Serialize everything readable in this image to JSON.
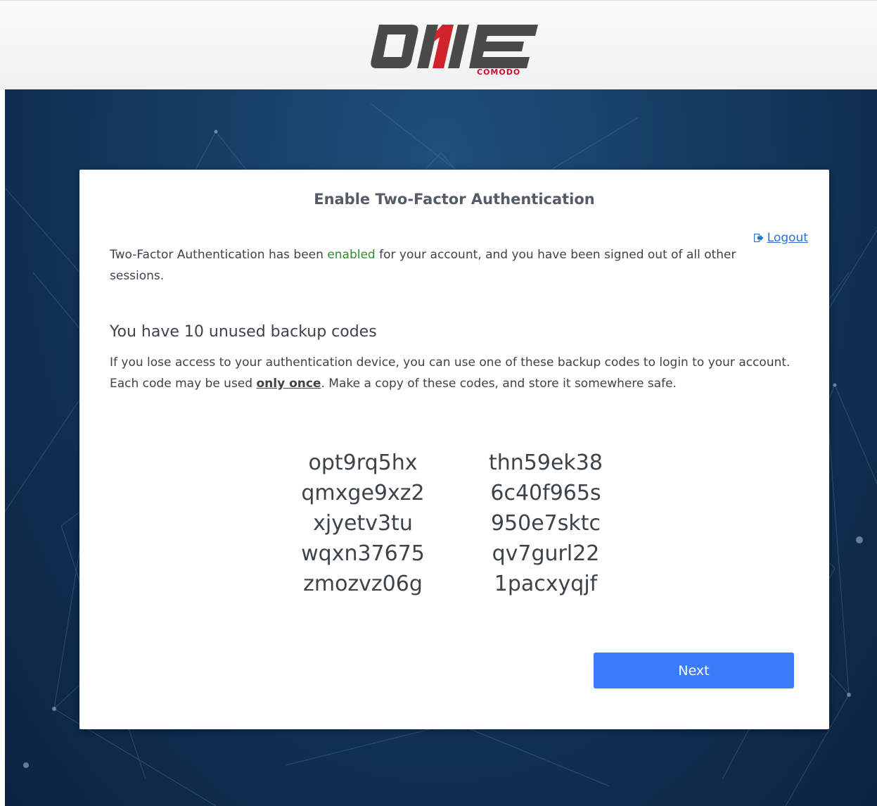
{
  "header": {
    "logo_alt": "ONE",
    "brand_sub": "COMODO"
  },
  "dialog": {
    "title": "Enable Two-Factor Authentication",
    "logout_label": "Logout",
    "status_before": "Two-Factor Authentication has been ",
    "status_highlight": "enabled",
    "status_after": " for your account, and you have been signed out of all other sessions.",
    "backup_heading": "You have 10 unused backup codes",
    "desc_before": "If you lose access to your authentication device, you can use one of these backup codes to login to your account. Each code may be used ",
    "desc_emph": "only once",
    "desc_after": ". Make a copy of these codes, and store it somewhere safe.",
    "codes_left": [
      "opt9rq5hx",
      "qmxge9xz2",
      "xjyetv3tu",
      "wqxn37675",
      "zmozvz06g"
    ],
    "codes_right": [
      "thn59ek38",
      "6c40f965s",
      "950e7sktc",
      "qv7gurl22",
      "1pacxyqjf"
    ],
    "next_label": "Next"
  },
  "colors": {
    "accent": "#3a7cf7",
    "enabled_green": "#2e8b2e",
    "link_blue": "#2b6fd6",
    "brand_red": "#c8102e",
    "background_navy": "#173f66"
  },
  "icons": {
    "logout": "sign-out-icon"
  }
}
